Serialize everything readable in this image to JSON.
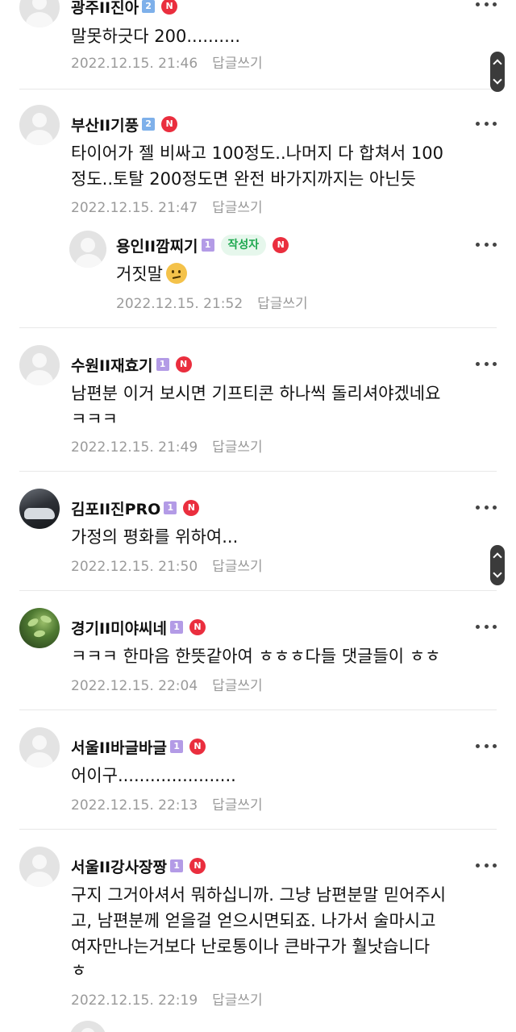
{
  "comments": [
    {
      "name": "광주II진아",
      "grade": "2",
      "badge": "N",
      "lines": [
        "말못하긋다 200.........."
      ],
      "date": "2022.12.15. 21:46",
      "reply_label": "답글쓰기"
    },
    {
      "name": "부산II기풍",
      "grade": "2",
      "badge": "N",
      "lines": [
        "타이어가 젤 비싸고 100정도..나머지 다 합쳐서 100",
        "정도..토탈 200정도면 완전 바가지까지는 아닌듯"
      ],
      "date": "2022.12.15. 21:47",
      "reply_label": "답글쓰기"
    },
    {
      "name": "용인II깜찌기",
      "grade": "1",
      "author_tag": "작성자",
      "badge": "N",
      "lines": [
        "거짓말"
      ],
      "emoji": "confused-face-icon",
      "date": "2022.12.15. 21:52",
      "reply_label": "답글쓰기"
    },
    {
      "name": "수원II재효기",
      "grade": "1",
      "badge": "N",
      "lines": [
        "남편분 이거 보시면 기프티콘 하나씩 돌리셔야겠네요",
        "ㅋㅋㅋ"
      ],
      "date": "2022.12.15. 21:49",
      "reply_label": "답글쓰기"
    },
    {
      "name": "김포II진PRO",
      "grade": "1",
      "badge": "N",
      "lines": [
        "가정의 평화를 위하여..."
      ],
      "date": "2022.12.15. 21:50",
      "reply_label": "답글쓰기"
    },
    {
      "name": "경기II미야씨네",
      "grade": "1",
      "badge": "N",
      "lines": [
        "ㅋㅋㅋ 한마음 한뜻같아여 ㅎㅎㅎ다들 댓글들이 ㅎㅎ"
      ],
      "date": "2022.12.15. 22:04",
      "reply_label": "답글쓰기"
    },
    {
      "name": "서울II바글바글",
      "grade": "1",
      "badge": "N",
      "lines": [
        "어이구......................"
      ],
      "date": "2022.12.15. 22:13",
      "reply_label": "답글쓰기"
    },
    {
      "name": "서울II강사장짱",
      "grade": "1",
      "badge": "N",
      "lines": [
        "구지 그거아셔서 뭐하십니까. 그냥 남편분말 믿어주시",
        "고, 남편분께 얻을걸 얻으시면되죠. 나가서 술마시고",
        "여자만나는거보다 난로통이나 큰바구가 훨낫습니다",
        "ㅎ"
      ],
      "date": "2022.12.15. 22:19",
      "reply_label": "답글쓰기"
    }
  ]
}
